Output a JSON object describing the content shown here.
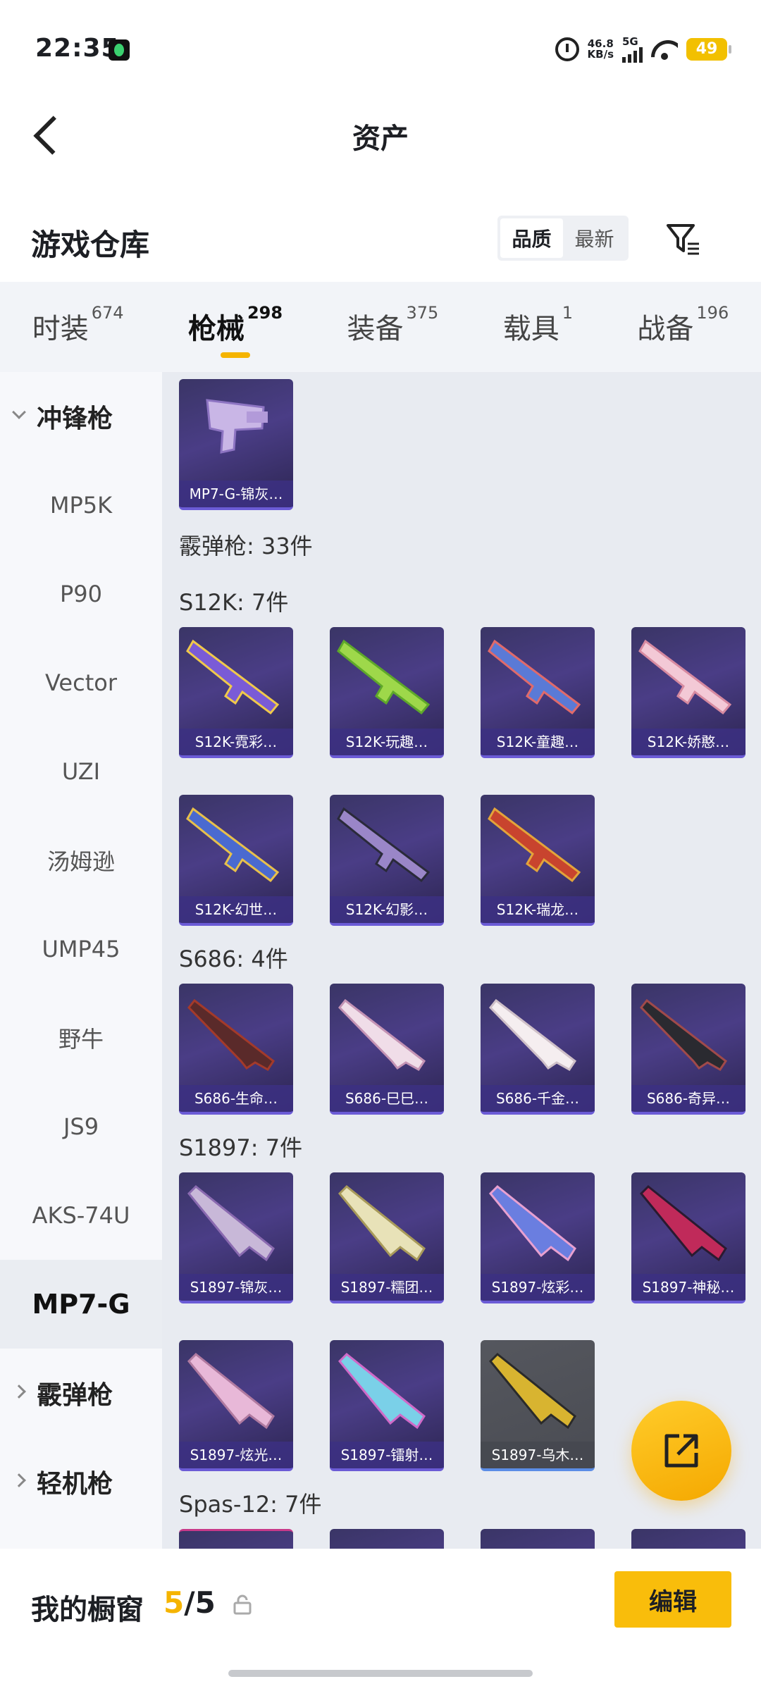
{
  "status_bar": {
    "time": "22:35",
    "net_speed_value": "46.8",
    "net_speed_unit": "KB/s",
    "network": "5G",
    "battery": "49"
  },
  "nav": {
    "title": "资产"
  },
  "warehouse": {
    "title": "游戏仓库",
    "sort_options": [
      "品质",
      "最新"
    ],
    "active_sort": "品质"
  },
  "tabs": [
    {
      "label": "时装",
      "count": "674"
    },
    {
      "label": "枪械",
      "count": "298"
    },
    {
      "label": "装备",
      "count": "375"
    },
    {
      "label": "载具",
      "count": "1"
    },
    {
      "label": "战备",
      "count": "196"
    }
  ],
  "active_tab": "枪械",
  "sidebar": {
    "group_smg": "冲锋枪",
    "items": [
      "MP5K",
      "P90",
      "Vector",
      "UZI",
      "汤姆逊",
      "UMP45",
      "野牛",
      "JS9",
      "AKS-74U"
    ],
    "selected_item": "MP7-G",
    "group_shotgun": "霰弹枪",
    "group_lmg": "轻机枪"
  },
  "content": {
    "mp7_cards": [
      "MP7-G-锦灰…"
    ],
    "shotgun_header": "霰弹枪: 33件",
    "s12k_header": "S12K: 7件",
    "s12k_cards": [
      "S12K-霓彩…",
      "S12K-玩趣…",
      "S12K-童趣…",
      "S12K-娇憨…",
      "S12K-幻世…",
      "S12K-幻影…",
      "S12K-瑞龙…"
    ],
    "s686_header": "S686: 4件",
    "s686_cards": [
      "S686-生命…",
      "S686-巳巳…",
      "S686-千金…",
      "S686-奇异…"
    ],
    "s1897_header": "S1897: 7件",
    "s1897_cards": [
      "S1897-锦灰…",
      "S1897-糯团…",
      "S1897-炫彩…",
      "S1897-神秘…",
      "S1897-炫光…",
      "S1897-镭射…",
      "S1897-乌木…"
    ],
    "spas_header": "Spas-12: 7件"
  },
  "bottom": {
    "showcase_label": "我的橱窗",
    "showcase_current": "5",
    "showcase_total": "/5",
    "edit_label": "编辑"
  },
  "colors": {
    "accent": "#f5b400",
    "card_bg": "#3a3566",
    "card_label_bg": "#3c3082"
  }
}
